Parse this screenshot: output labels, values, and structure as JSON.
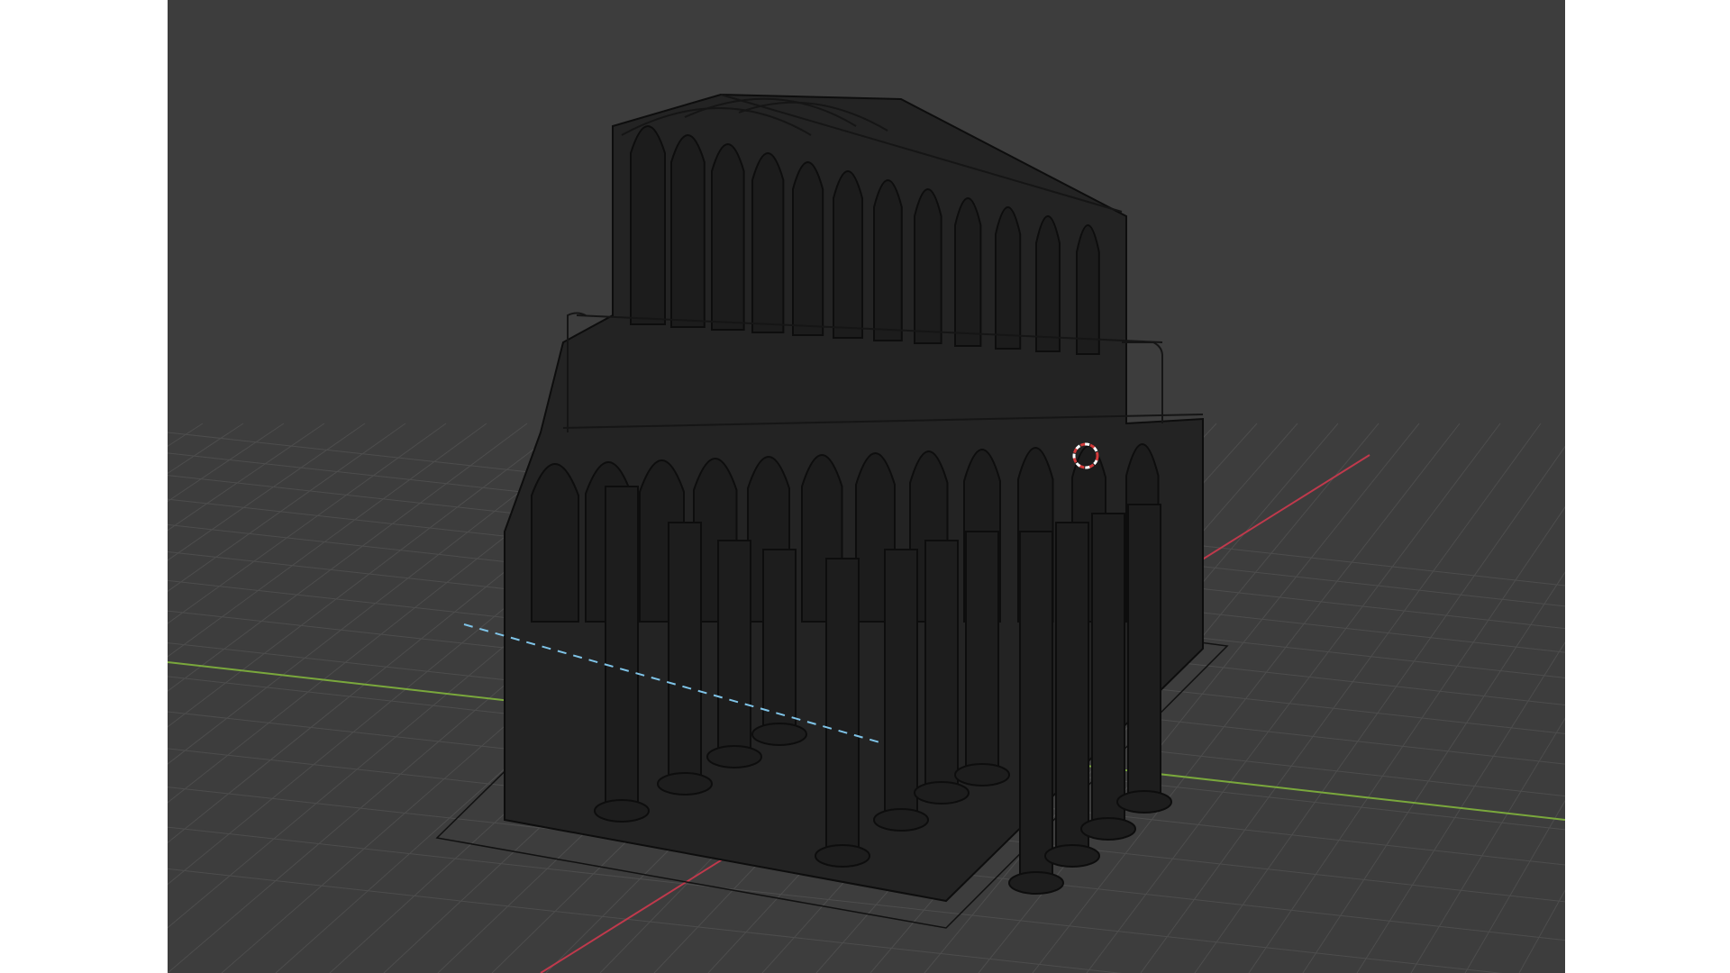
{
  "app": {
    "name": "3D Viewport"
  },
  "viewport": {
    "shading": "wireframe",
    "scene_object": "gothic-cathedral-nave",
    "background_color": "#3d3d3d",
    "grid_color": "#4f4f4f",
    "x_axis_color": "#c0394c",
    "y_axis_color": "#7aa83c",
    "camera_line_color": "#7fc4e8",
    "wire_color": "#0d0d0d",
    "fill_color": "#232323",
    "cursor_colors": [
      "#d23b3b",
      "#ffffff"
    ]
  },
  "icons": {
    "cursor": "3d-cursor-icon"
  }
}
